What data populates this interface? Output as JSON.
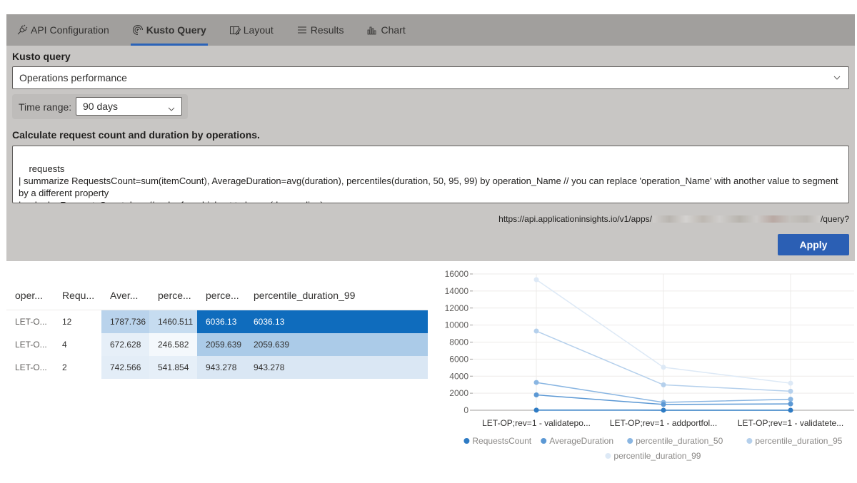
{
  "tabs": [
    {
      "label": "API Configuration",
      "icon": "plug-icon",
      "active": false
    },
    {
      "label": "Kusto Query",
      "icon": "radar-icon",
      "active": true
    },
    {
      "label": "Layout",
      "icon": "layout-edit-icon",
      "active": false
    },
    {
      "label": "Results",
      "icon": "list-icon",
      "active": false
    },
    {
      "label": "Chart",
      "icon": "bar-chart-icon",
      "active": false
    }
  ],
  "query_panel": {
    "label": "Kusto query",
    "selected_query": "Operations performance",
    "time_range_label": "Time range:",
    "time_range_value": "90 days",
    "description": "Calculate request count and duration by operations.",
    "query_text": "requests\n| summarize RequestsCount=sum(itemCount), AverageDuration=avg(duration), percentiles(duration, 50, 95, 99) by operation_Name // you can replace 'operation_Name' with another value to segment by a different property\n| order by RequestsCount desc // order from highest to lower (descending)",
    "url_prefix": "https://api.applicationinsights.io/v1/apps/",
    "url_suffix": "/query?",
    "apply_label": "Apply"
  },
  "results_table": {
    "headers": [
      "oper...",
      "Requ...",
      "Aver...",
      "perce...",
      "perce...",
      "percentile_duration_99"
    ],
    "rows": [
      {
        "cells": [
          "LET-O...",
          "12",
          "1787.736",
          "1460.511",
          "6036.13",
          "6036.13"
        ],
        "colors": [
          "#ffffff",
          "#ffffff",
          "#b9d3ec",
          "#c6dcf0",
          "#0f6cbd",
          "#0f6cbd"
        ],
        "text_colors": [
          "#605e5c",
          "#323130",
          "#323130",
          "#323130",
          "#ffffff",
          "#ffffff"
        ]
      },
      {
        "cells": [
          "LET-O...",
          "4",
          "672.628",
          "246.582",
          "2059.639",
          "2059.639"
        ],
        "colors": [
          "#ffffff",
          "#ffffff",
          "#e6eff8",
          "#f4f8fc",
          "#abcbe8",
          "#abcbe8"
        ],
        "text_colors": [
          "#605e5c",
          "#323130",
          "#323130",
          "#323130",
          "#323130",
          "#323130"
        ]
      },
      {
        "cells": [
          "LET-O...",
          "2",
          "742.566",
          "541.854",
          "943.278",
          "943.278"
        ],
        "colors": [
          "#ffffff",
          "#ffffff",
          "#e3edf7",
          "#e6eff8",
          "#dae7f4",
          "#dae7f4"
        ],
        "text_colors": [
          "#605e5c",
          "#323130",
          "#323130",
          "#323130",
          "#323130",
          "#323130"
        ]
      }
    ]
  },
  "chart_data": {
    "type": "line",
    "stacked": true,
    "categories": [
      "LET-OP;rev=1 - validatepo...",
      "LET-OP;rev=1 - addportfol...",
      "LET-OP;rev=1 - validatete..."
    ],
    "series": [
      {
        "name": "RequestsCount",
        "values": [
          12,
          4,
          2
        ],
        "color": "#2e7bc4"
      },
      {
        "name": "AverageDuration",
        "values": [
          1787.736,
          672.628,
          742.566
        ],
        "color": "#5b98d4"
      },
      {
        "name": "percentile_duration_50",
        "values": [
          1460.511,
          246.582,
          541.854
        ],
        "color": "#8ab6e2"
      },
      {
        "name": "percentile_duration_95",
        "values": [
          6036.13,
          2059.639,
          943.278
        ],
        "color": "#b5d0ec"
      },
      {
        "name": "percentile_duration_99",
        "values": [
          6036.13,
          2059.639,
          943.278
        ],
        "color": "#dde9f6"
      }
    ],
    "yticks": [
      0,
      2000,
      4000,
      6000,
      8000,
      10000,
      12000,
      14000,
      16000
    ],
    "ylim": [
      0,
      16000
    ],
    "grid": true,
    "legend": "bottom",
    "title": "",
    "xlabel": "",
    "ylabel": ""
  }
}
